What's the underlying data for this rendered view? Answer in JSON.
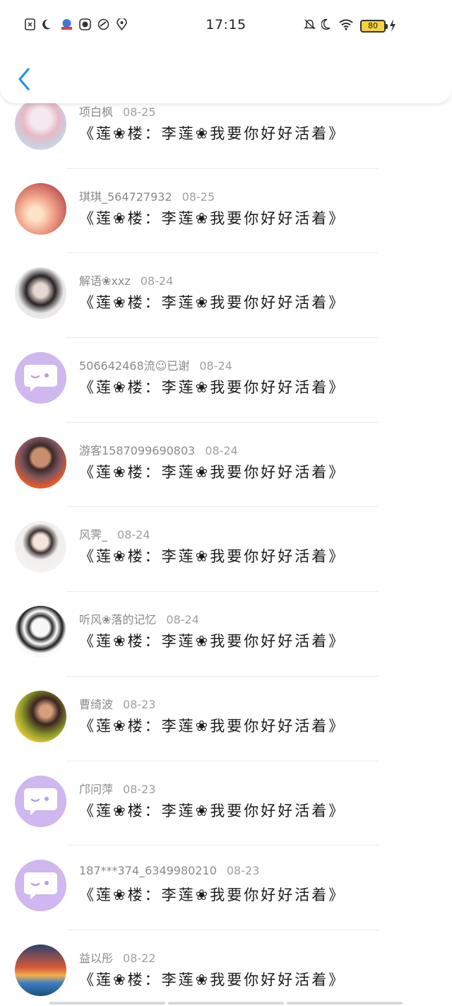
{
  "status_bar": {
    "time": "17:15",
    "battery": "80",
    "left_icons": [
      "sim-missing-icon",
      "moon-icon",
      "app-badge-icon",
      "media-icon",
      "sync-icon",
      "location-icon"
    ],
    "right_icons": [
      "mute-bell-icon",
      "moon-icon",
      "wifi-icon",
      "battery-icon",
      "charging-icon"
    ]
  },
  "header": {
    "back_icon": "chevron-left-icon",
    "accent": "#2a8ef2"
  },
  "comments": [
    {
      "user": "项白枫",
      "date": "08-25",
      "text": "《莲❀楼：李莲❀我要你好好活着》",
      "avatar": "photo-pink-girl"
    },
    {
      "user": "琪琪_564727932",
      "date": "08-25",
      "text": "《莲❀楼：李莲❀我要你好好活着》",
      "avatar": "photo-blossom"
    },
    {
      "user": "解语❀xxz",
      "date": "08-24",
      "text": "《莲❀楼：李莲❀我要你好好活着》",
      "avatar": "photo-dark-boy"
    },
    {
      "user": "506642468流☺已谢",
      "date": "08-24",
      "text": "《莲❀楼：李莲❀我要你好好活着》",
      "avatar": "default-chat"
    },
    {
      "user": "游客1587099690803",
      "date": "08-24",
      "text": "《莲❀楼：李莲❀我要你好好活着》",
      "avatar": "photo-child"
    },
    {
      "user": "风霁_",
      "date": "08-24",
      "text": "《莲❀楼：李莲❀我要你好好活着》",
      "avatar": "photo-cartoon"
    },
    {
      "user": "听风❀落的记忆",
      "date": "08-24",
      "text": "《莲❀楼：李莲❀我要你好好活着》",
      "avatar": "photo-meme"
    },
    {
      "user": "曹绮波",
      "date": "08-23",
      "text": "《莲❀楼：李莲❀我要你好好活着》",
      "avatar": "photo-woman-field"
    },
    {
      "user": "邝问萍",
      "date": "08-23",
      "text": "《莲❀楼：李莲❀我要你好好活着》",
      "avatar": "default-chat"
    },
    {
      "user": "187***374_6349980210",
      "date": "08-23",
      "text": "《莲❀楼：李莲❀我要你好好活着》",
      "avatar": "default-chat"
    },
    {
      "user": "益以彤",
      "date": "08-22",
      "text": "《莲❀楼：李莲❀我要你好好活着》",
      "avatar": "photo-sunset-palm"
    }
  ]
}
